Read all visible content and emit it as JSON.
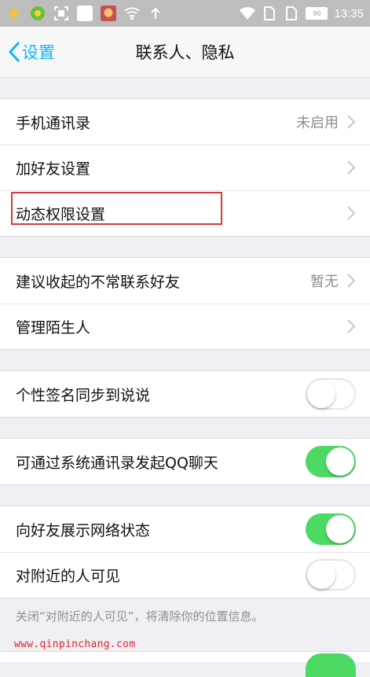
{
  "statusbar": {
    "time": "13:35",
    "battery": "90"
  },
  "nav": {
    "back_label": "设置",
    "title": "联系人、隐私"
  },
  "groups": [
    {
      "rows": [
        {
          "label": "手机通讯录",
          "value": "未启用"
        },
        {
          "label": "加好友设置"
        },
        {
          "label": "动态权限设置"
        }
      ]
    },
    {
      "rows": [
        {
          "label": "建议收起的不常联系好友",
          "value": "暂无"
        },
        {
          "label": "管理陌生人"
        }
      ]
    },
    {
      "rows": [
        {
          "label": "个性签名同步到说说",
          "toggle": "off"
        }
      ]
    },
    {
      "rows": [
        {
          "label": "可通过系统通讯录发起QQ聊天",
          "toggle": "on"
        }
      ]
    },
    {
      "rows": [
        {
          "label": "向好友展示网络状态",
          "toggle": "on"
        },
        {
          "label": "对附近的人可见",
          "toggle": "off"
        }
      ]
    }
  ],
  "footnote": "关闭“对附近的人可见”，将清除你的位置信息。",
  "watermark": "www.qinpinchang.com",
  "colors": {
    "accent": "#12b7f5",
    "switch_on": "#4cd964",
    "highlight": "#d9363e"
  }
}
